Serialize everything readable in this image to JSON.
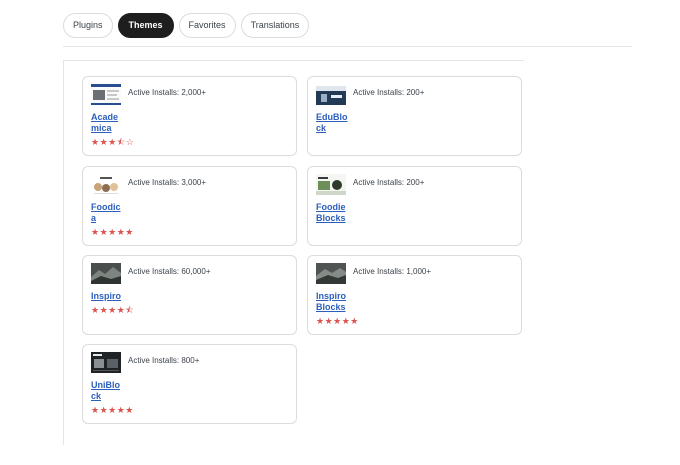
{
  "tabs": [
    {
      "label": "Plugins",
      "active": false
    },
    {
      "label": "Themes",
      "active": true
    },
    {
      "label": "Favorites",
      "active": false
    },
    {
      "label": "Translations",
      "active": false
    }
  ],
  "themes": [
    {
      "name": "Academica",
      "installs": "Active Installs: 2,000+",
      "rating": 3.5,
      "stars": "★★★⯪☆"
    },
    {
      "name": "EduBlock",
      "installs": "Active Installs: 200+",
      "rating": null,
      "stars": ""
    },
    {
      "name": "Foodica",
      "installs": "Active Installs: 3,000+",
      "rating": 5,
      "stars": "★★★★★"
    },
    {
      "name": "Foodie Blocks",
      "installs": "Active Installs: 200+",
      "rating": null,
      "stars": ""
    },
    {
      "name": "Inspiro",
      "installs": "Active Installs: 60,000+",
      "rating": 4.5,
      "stars": "★★★★⯪"
    },
    {
      "name": "Inspiro Blocks",
      "installs": "Active Installs: 1,000+",
      "rating": 5,
      "stars": "★★★★★"
    },
    {
      "name": "UniBlock",
      "installs": "Active Installs: 800+",
      "rating": 5,
      "stars": "★★★★★"
    }
  ],
  "colors": {
    "accent": "#1e1e1e",
    "link": "#2c5fbc",
    "star": "#d9534f"
  }
}
